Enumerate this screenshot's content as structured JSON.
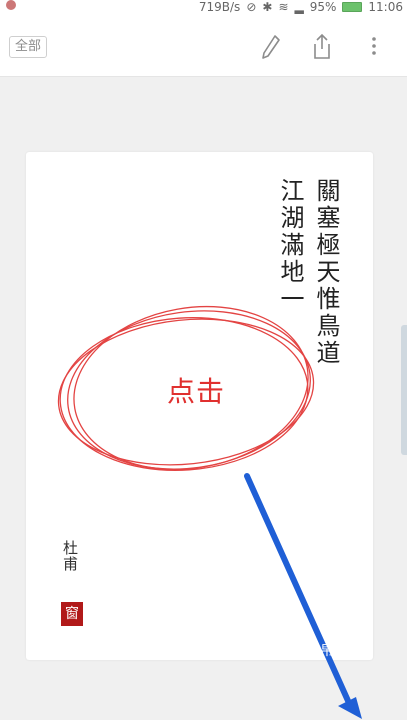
{
  "status_bar": {
    "speed": "719B/s",
    "battery": "95%",
    "time": "11:06"
  },
  "toolbar": {
    "all_label": "全部",
    "icons": [
      "pen-icon",
      "share-icon",
      "more-icon"
    ]
  },
  "poem": {
    "col1": "關塞極天惟鳥道",
    "col2": "江湖滿地一",
    "author": "杜甫",
    "seal": "窗"
  },
  "annotation": {
    "label": "点击",
    "color": "#e0302f",
    "arrow_color": "#1f5fd6"
  },
  "overlay_text": "帛"
}
